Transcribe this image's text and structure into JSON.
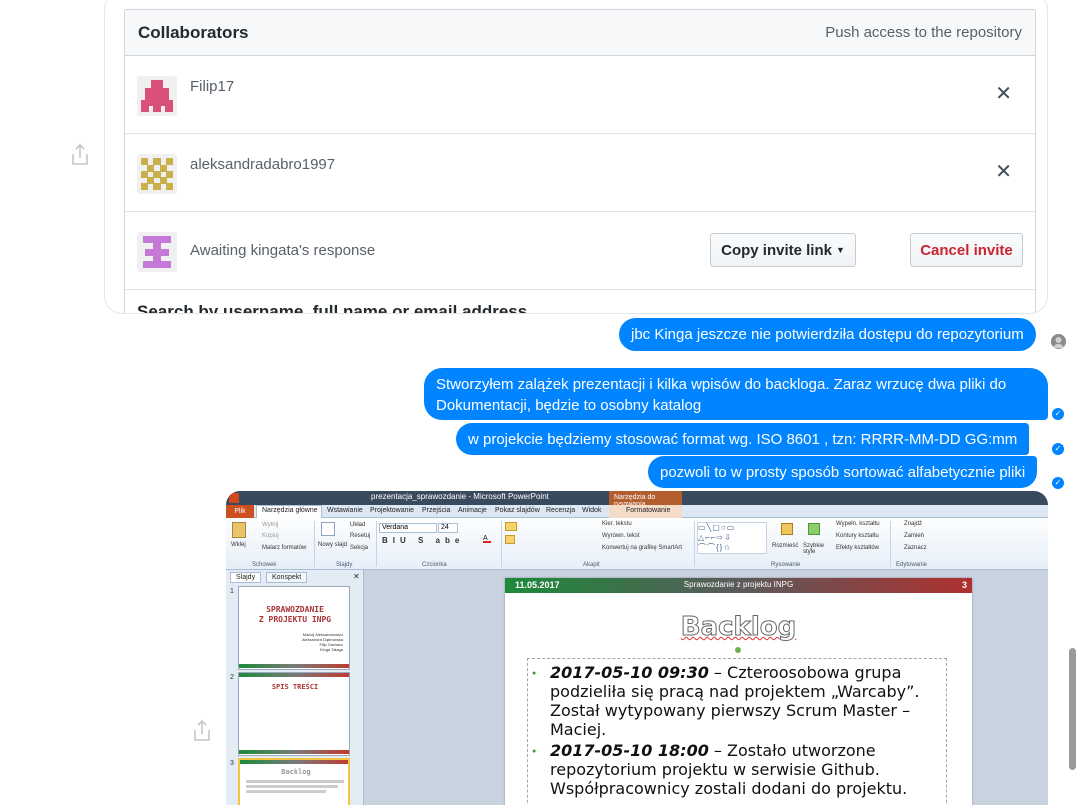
{
  "collaborators": {
    "title": "Collaborators",
    "subtitle": "Push access to the repository",
    "members": [
      {
        "name": "Filip17"
      },
      {
        "name": "aleksandradabro1997"
      }
    ],
    "pending": {
      "text": "Awaiting kingata's response",
      "copy_label": "Copy invite link",
      "cancel_label": "Cancel invite"
    },
    "search_placeholder": "Search by username, full name or email address"
  },
  "messages": [
    {
      "text": "jbc Kinga jeszcze nie potwierdziła dostępu do repozytorium"
    },
    {
      "text": "Stworzyłem zalążek prezentacji i kilka wpisów do backloga. Zaraz wrzucę dwa pliki do Dokumentacji, będzie to osobny katalog"
    },
    {
      "text": "w projekcie będziemy stosować format wg. ISO 8601 , tzn: RRRR-MM-DD GG:mm"
    },
    {
      "text": "pozwoli to w prosty sposób sortować alfabetycznie pliki"
    }
  ],
  "ppt": {
    "window_title": "prezentacja_sprawozdanie - Microsoft PowerPoint",
    "contextual_tools": "Narzędzia do rysowania",
    "tabs": [
      "Plik",
      "Narzędzia główne",
      "Wstawianie",
      "Projektowanie",
      "Przejścia",
      "Animacje",
      "Pokaz slajdów",
      "Recenzja",
      "Widok",
      "Formatowanie"
    ],
    "ribbon": {
      "paste": "Wklej",
      "cut": "Wytnij",
      "copy": "Kopiuj",
      "painter": "Malarz formatów",
      "new_slide": "Nowy slajd",
      "layout": "Układ",
      "reset": "Resetuj",
      "section": "Sekcja",
      "font": "Verdana",
      "size": "24",
      "text_dir": "Kier. tekstu",
      "align_text": "Wyrówn. tekst",
      "smartart": "Konwertuj na grafikę SmartArt",
      "arrange": "Rozmieść",
      "quick_styles": "Szybkie style",
      "fill": "Wypełn. kształtu",
      "outline": "Kontury kształtu",
      "effects": "Efekty kształtów",
      "find": "Znajdź",
      "replace": "Zamień",
      "select": "Zaznacz",
      "groups": [
        "Schowek",
        "Slajdy",
        "Czcionka",
        "Akapit",
        "Rysowanie",
        "Edytowanie"
      ]
    },
    "panel_tabs": [
      "Slajdy",
      "Konspekt"
    ],
    "thumbs": [
      {
        "num": "1",
        "title_line1": "SPRAWOZDANIE",
        "title_line2": "Z PROJEKTU INPG",
        "names": [
          "Maciej Aleksandrowicz",
          "Aleksandra Dąbrowska",
          "Filip Garbacz",
          "Kinga Tałaga"
        ]
      },
      {
        "num": "2",
        "title": "SPIS TREŚCI"
      },
      {
        "num": "3",
        "title": "Backlog"
      }
    ],
    "slide": {
      "date": "11.05.2017",
      "header_center": "Sprawozdanie z projektu INPG",
      "number": "3",
      "title": "Backlog",
      "items": [
        {
          "date": "2017-05-10 09:30",
          "text": " – Czteroosobowa grupa podzieliła się pracą nad projektem „Warcaby”. Został wytypowany pierwszy Scrum Master – Maciej."
        },
        {
          "date": "2017-05-10 18:00",
          "text": " – Zostało utworzone repozytorium projektu w serwisie Github. Współpracownicy zostali dodani do projektu."
        }
      ]
    }
  }
}
